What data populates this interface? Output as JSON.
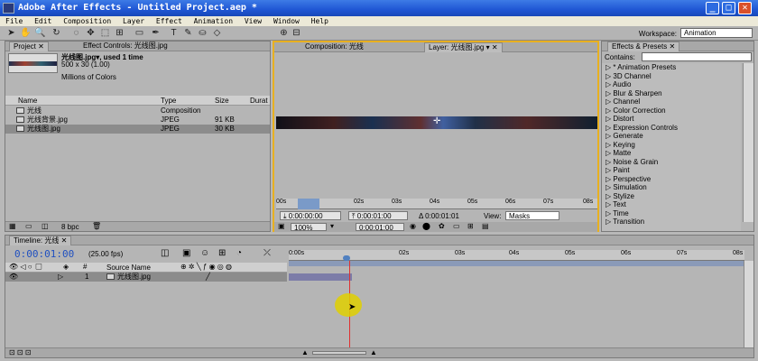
{
  "window": {
    "title": "Adobe After Effects - Untitled Project.aep *",
    "minimize": "_",
    "maximize": "□",
    "close": "✕"
  },
  "menu": [
    "File",
    "Edit",
    "Composition",
    "Layer",
    "Effect",
    "Animation",
    "View",
    "Window",
    "Help"
  ],
  "toolbar": {
    "workspace_label": "Workspace:",
    "workspace_value": "Animation",
    "tools": [
      "selection-tool",
      "hand-tool",
      "zoom-tool",
      "rotate-tool",
      "orbit-camera-tool",
      "track-xy-tool",
      "track-z-tool",
      "pan-behind-tool",
      "rectangle-mask-tool",
      "pen-tool",
      "text-tool",
      "brush-tool",
      "clone-stamp-tool",
      "eraser-tool",
      "local-axis-mode",
      "world-axis-mode"
    ]
  },
  "project_panel": {
    "tab_project": "Project",
    "tab_effect_controls": "Effect Controls: 光线图.jpg",
    "preview_name": "光线图.jpg▾, used 1 time",
    "preview_size": "500 x 30 (1.00)",
    "preview_color": "Millions of Colors",
    "columns": [
      "Name",
      "Type",
      "Size",
      "Durat"
    ],
    "items": [
      {
        "name": "光线",
        "type": "Composition",
        "size": "",
        "selected": false
      },
      {
        "name": "光线背景.jpg",
        "type": "JPEG",
        "size": "91 KB",
        "selected": false
      },
      {
        "name": "光线图.jpg",
        "type": "JPEG",
        "size": "30 KB",
        "selected": true
      }
    ],
    "bpc": "8 bpc"
  },
  "viewer": {
    "tab_composition": "Composition: 光线",
    "tab_layer": "Layer: 光线图.jpg",
    "ruler_ticks": [
      "00s",
      "02s",
      "03s",
      "04s",
      "05s",
      "06s",
      "07s",
      "08s"
    ],
    "in_point": "0:00:00:00",
    "out_point": "0:00:01:00",
    "duration": "Δ 0:00:01:01",
    "view_label": "View:",
    "view_value": "Masks",
    "zoom": "100%",
    "time": "0:00:01:00"
  },
  "effects_panel": {
    "tab": "Effects & Presets",
    "contains_label": "Contains:",
    "search_value": "",
    "categories": [
      "* Animation Presets",
      "3D Channel",
      "Audio",
      "Blur & Sharpen",
      "Channel",
      "Color Correction",
      "Distort",
      "Expression Controls",
      "Generate",
      "Keying",
      "Matte",
      "Noise & Grain",
      "Paint",
      "Perspective",
      "Simulation",
      "Stylize",
      "Text",
      "Time",
      "Transition"
    ]
  },
  "timeline": {
    "tab": "Timeline: 光线",
    "current_time": "0:00:01:00",
    "fps": "(25.00 fps)",
    "source_header": "Source Name",
    "ticks": [
      "0:00s",
      "02s",
      "03s",
      "04s",
      "05s",
      "06s",
      "07s",
      "08s"
    ],
    "layers": [
      {
        "index": "1",
        "name": "光线图.jpg"
      }
    ]
  },
  "colors": {
    "title_bar": "#1f56d4",
    "accent_orange": "#e8b020",
    "cti_red": "#e03030",
    "timecode_blue": "#2050c0",
    "cursor_highlight": "#e0d000"
  }
}
